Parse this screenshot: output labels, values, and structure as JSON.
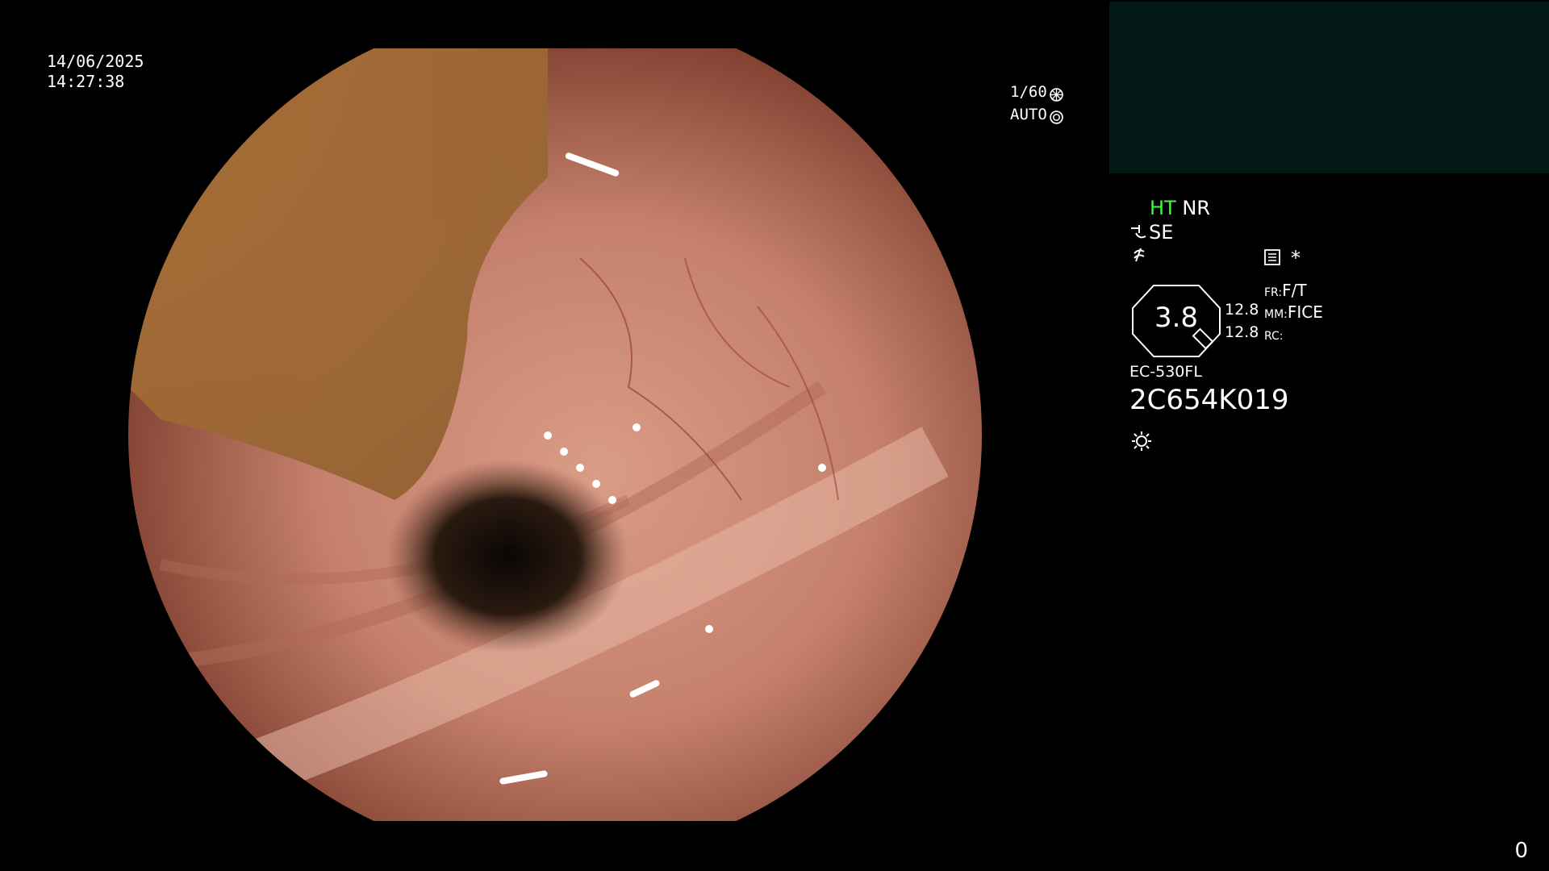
{
  "timestamp": {
    "date": "14/06/2025",
    "time": "14:27:38"
  },
  "shutter": {
    "speed": "1/60",
    "iris": "AUTO",
    "speed_icon": "shutter-icon",
    "iris_icon": "iris-icon"
  },
  "status": {
    "ht": "HT",
    "nr": "NR",
    "se": "SE",
    "se_icon": "enhance-icon",
    "edge_icon": "edge-icon",
    "menu_icon": "menu-list-icon",
    "star": "*"
  },
  "gauge": {
    "value": "3.8",
    "line1": "12.8",
    "line2": "12.8"
  },
  "modes": {
    "fr_label": "FR:",
    "fr_value": "F/T",
    "mm_label": "MM:",
    "mm_value": "FICE",
    "rc_label": "RC:",
    "rc_value": ""
  },
  "scope": {
    "model": "EC-530FL",
    "serial": "2C654K019",
    "light_icon": "light-sun-icon"
  },
  "counter": "0",
  "colors": {
    "panel_bg": "#041a16",
    "ht_green": "#3cff3c",
    "text": "#ffffff"
  }
}
